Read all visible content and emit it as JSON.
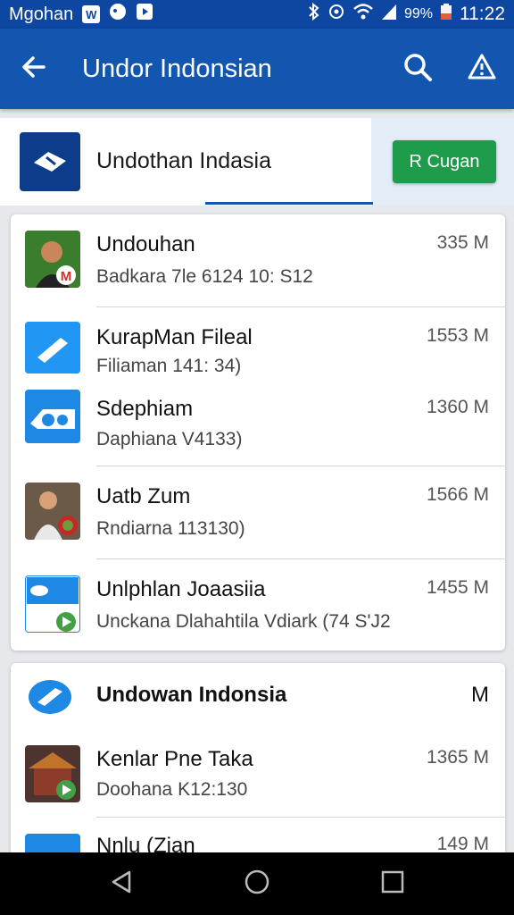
{
  "status_bar": {
    "carrier": "Mgohan",
    "battery": "99%",
    "time": "11:22"
  },
  "app_bar": {
    "title": "Undor Indonsian"
  },
  "header": {
    "title": "Undothan Indasia",
    "button_label": "R Cugan"
  },
  "list_1": [
    {
      "title": "Undouhan",
      "subtitle": "Badkara 7le 6124 10: S12",
      "size": "335 M"
    },
    {
      "title": "KurapMan Fileal",
      "subtitle": "Filiaman 141: 34)",
      "size": "1553 M"
    },
    {
      "title": "Sdephiam",
      "subtitle": "Daphiana V4133)",
      "size": "1360 M"
    },
    {
      "title": "Uatb Zum",
      "subtitle": "Rndiarna 113130)",
      "size": "1566 M"
    },
    {
      "title": "Unlphlan Joaasiia",
      "subtitle": "Unckana Dlahahtila Vdiark (74 S'J2",
      "size": "1455 M"
    }
  ],
  "section_2": {
    "title": "Undowan Indonsia",
    "size": "M"
  },
  "list_2": [
    {
      "title": "Kenlar Pne Taka",
      "subtitle": "Doohana K12:130",
      "size": "1365 M"
    },
    {
      "title": "Nnlu (Zian",
      "subtitle": "",
      "size": "149 M"
    }
  ],
  "colors": {
    "primary": "#1256b0",
    "status": "#0d47a1",
    "accent_green": "#1e9b4b"
  }
}
